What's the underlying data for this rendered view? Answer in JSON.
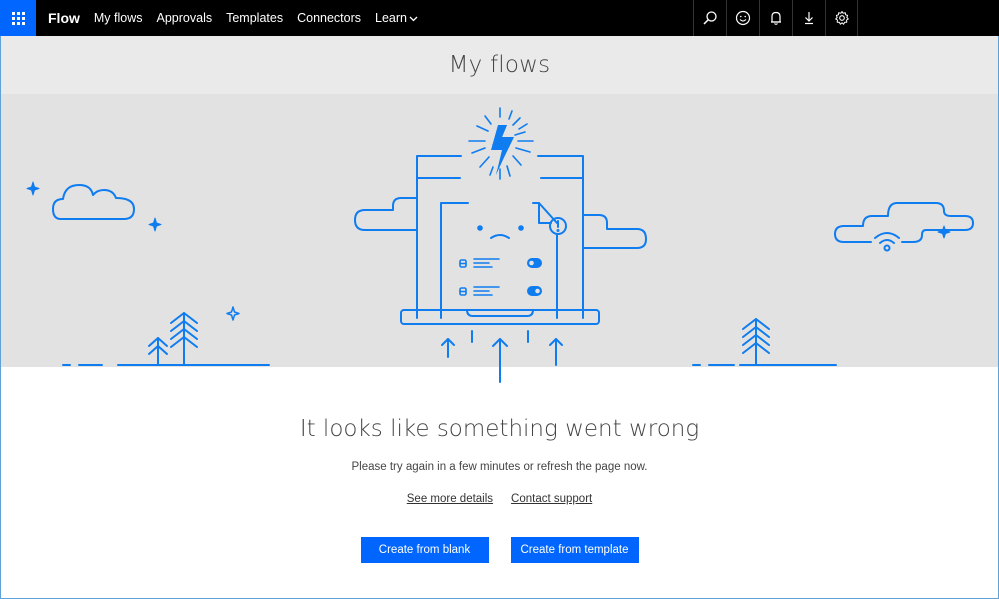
{
  "topbar": {
    "app_launcher_icon": "waffle-icon",
    "brand": "Flow",
    "nav": [
      {
        "label": "My flows"
      },
      {
        "label": "Approvals"
      },
      {
        "label": "Templates"
      },
      {
        "label": "Connectors"
      },
      {
        "label": "Learn",
        "has_dropdown": true
      }
    ],
    "learn_chevron": "⌄",
    "right_icons": [
      "search-icon",
      "smiley-icon",
      "bell-icon",
      "download-icon",
      "gear-icon"
    ]
  },
  "page": {
    "title": "My flows"
  },
  "illustration": {
    "accent_color": "#0f7cf0",
    "background_color": "#e2e2e2"
  },
  "error": {
    "title": "It looks like something went wrong",
    "subtitle": "Please try again in a few minutes or refresh the page now.",
    "links": {
      "details": "See more details",
      "support": "Contact support"
    }
  },
  "actions": {
    "create_blank": "Create from blank",
    "create_template": "Create from template"
  },
  "colors": {
    "brand_blue": "#0066ff",
    "topbar_bg": "#000000",
    "title_bar_bg": "#eaeaea"
  }
}
